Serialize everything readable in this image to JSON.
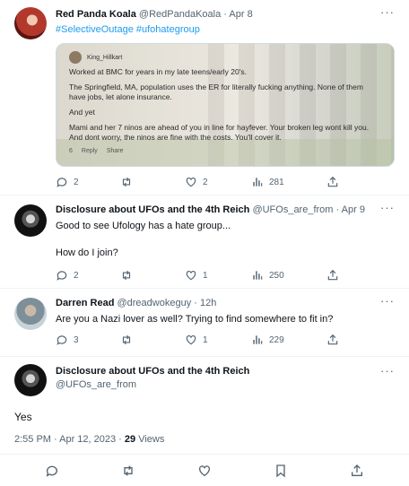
{
  "tweets": [
    {
      "name": "Red Panda Koala",
      "handle": "@RedPandaKoala",
      "sep": "·",
      "time": "Apr 8",
      "hashtags": "#SelectiveOutage #ufohategroup",
      "embed": {
        "author": "King_Hillkart",
        "lines": [
          "Worked at BMC for years in my late teens/early 20's.",
          "The Springfield, MA, population uses the ER for literally fucking anything. None of them have jobs, let alone insurance.",
          "And yet",
          "Mami and her 7 ninos are ahead of you in line for hayfever. Your broken leg wont kill you. And dont worry, the ninos are fine with the costs. You'll cover it."
        ],
        "likes": "6",
        "reply": "Reply",
        "share": "Share"
      },
      "replies": "2",
      "retweets": "",
      "likes": "2",
      "views": "281"
    },
    {
      "name": "Disclosure about UFOs and the 4th Reich",
      "handle": "@UFOs_are_from",
      "sep": "·",
      "time": "Apr 9",
      "text1": "Good to see Ufology has a hate group...",
      "text2": "How do I join?",
      "replies": "2",
      "retweets": "",
      "likes": "1",
      "views": "250"
    },
    {
      "name": "Darren Read",
      "handle": "@dreadwokeguy",
      "sep": "·",
      "time": "12h",
      "text1": "Are you a Nazi lover as well? Trying to find somewhere to fit in?",
      "replies": "3",
      "retweets": "",
      "likes": "1",
      "views": "229"
    }
  ],
  "main_tweet": {
    "name": "Disclosure about UFOs and the 4th Reich",
    "handle": "@UFOs_are_from",
    "text": "Yes",
    "timestamp": "2:55 PM · Apr 12, 2023 · ",
    "views_count": "29",
    "views_label": " Views"
  },
  "more": "···",
  "icons": [
    "reply-icon",
    "retweet-icon",
    "like-icon",
    "views-icon",
    "share-icon",
    "bookmark-icon"
  ],
  "colors": {
    "text": "#0f1419",
    "secondary": "#536471",
    "link": "#1d9bf0",
    "border": "#eff3f4"
  }
}
